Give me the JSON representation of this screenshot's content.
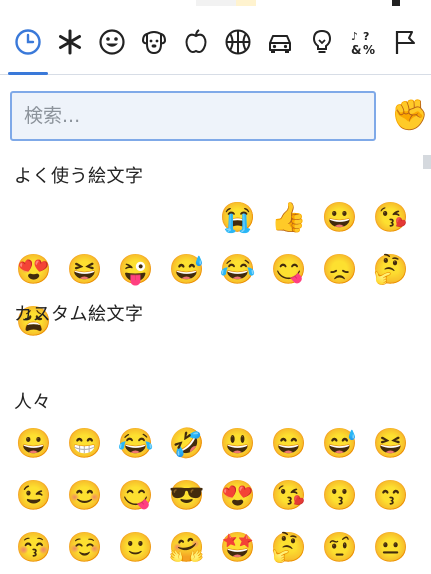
{
  "tabs": [
    {
      "name": "recent-tab",
      "icon": "clock-icon",
      "active": true
    },
    {
      "name": "custom-tab",
      "icon": "asterisk-icon"
    },
    {
      "name": "people-tab",
      "icon": "smiley-icon"
    },
    {
      "name": "nature-tab",
      "icon": "dog-icon"
    },
    {
      "name": "food-tab",
      "icon": "apple-icon"
    },
    {
      "name": "activity-tab",
      "icon": "basketball-icon"
    },
    {
      "name": "travel-tab",
      "icon": "car-icon"
    },
    {
      "name": "objects-tab",
      "icon": "lightbulb-icon"
    },
    {
      "name": "symbols-tab",
      "icon": "symbols-icon"
    },
    {
      "name": "flags-tab",
      "icon": "flag-icon"
    }
  ],
  "colors": {
    "accent": "#3a79d9",
    "icon_stroke": "#222222"
  },
  "search": {
    "placeholder": "検索...",
    "value": ""
  },
  "skin_tone": "✊",
  "sections": {
    "frequent": {
      "title": "よく使う絵文字",
      "emojis": [
        "",
        "",
        "",
        "",
        "😭",
        "👍",
        "😀",
        "😘",
        "😍",
        "😆",
        "😜",
        "😅",
        "😂",
        "😋",
        "😞",
        "🤔",
        "😩"
      ]
    },
    "custom": {
      "title": "カスタム絵文字"
    },
    "people": {
      "title": "人々",
      "emojis": [
        "😀",
        "😁",
        "😂",
        "🤣",
        "😃",
        "😄",
        "😅",
        "😆",
        "😉",
        "😊",
        "😋",
        "😎",
        "😍",
        "😘",
        "😗",
        "😙",
        "😚",
        "☺️",
        "🙂",
        "🤗",
        "🤩",
        "🤔",
        "🤨",
        "😐"
      ]
    }
  }
}
